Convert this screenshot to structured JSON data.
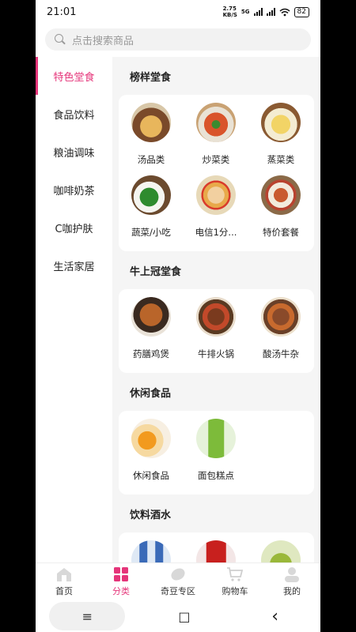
{
  "status": {
    "time": "21:01",
    "net_speed_top": "2.75",
    "net_speed_bottom": "KB/S",
    "net_type": "5G",
    "battery": "82"
  },
  "search": {
    "placeholder": "点击搜索商品"
  },
  "sidebar": {
    "items": [
      {
        "label": "特色堂食",
        "active": true
      },
      {
        "label": "食品饮料"
      },
      {
        "label": "粮油调味"
      },
      {
        "label": "咖啡奶茶"
      },
      {
        "label": "C咖护肤"
      },
      {
        "label": "生活家居"
      }
    ]
  },
  "sections": [
    {
      "title": "榜样堂食",
      "items": [
        "汤品类",
        "炒菜类",
        "蒸菜类",
        "蔬菜/小吃",
        "电信1分...",
        "特价套餐"
      ]
    },
    {
      "title": "牛上冠堂食",
      "items": [
        "药膳鸡煲",
        "牛排火锅",
        "酸汤牛杂"
      ]
    },
    {
      "title": "休闲食品",
      "items": [
        "休闲食品",
        "面包糕点"
      ]
    },
    {
      "title": "饮料酒水",
      "items": [
        "",
        "",
        ""
      ]
    }
  ],
  "nav": {
    "items": [
      {
        "label": "首页",
        "icon": "home-icon"
      },
      {
        "label": "分类",
        "icon": "category-icon",
        "active": true
      },
      {
        "label": "奇豆专区",
        "icon": "bean-icon"
      },
      {
        "label": "购物车",
        "icon": "cart-icon"
      },
      {
        "label": "我的",
        "icon": "user-icon"
      }
    ]
  },
  "system_nav": {
    "menu": "≡",
    "home": "□",
    "back": "‹"
  },
  "colors": {
    "accent": "#e5357a"
  }
}
